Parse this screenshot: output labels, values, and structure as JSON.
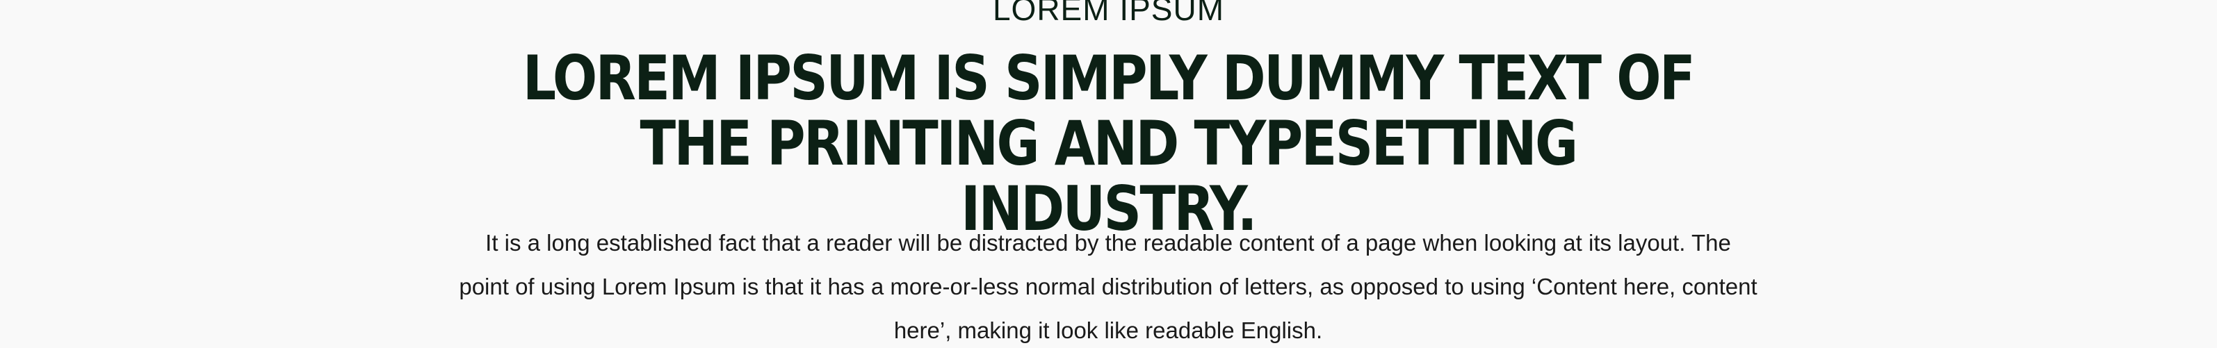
{
  "section": {
    "eyebrow": "LOREM IPSUM",
    "headline": "LOREM IPSUM IS SIMPLY DUMMY TEXT OF THE PRINTING AND TYPESETTING INDUSTRY.",
    "body": "It is a long established fact that a reader will be distracted by the readable content of a page when looking at its layout. The point of using Lorem Ipsum is that it has a more-or-less normal distribution of letters, as opposed to using ‘Content here, content here’, making it look like readable English."
  },
  "colors": {
    "background": "#f9f9f9",
    "text_dark_green": "#0c2015"
  }
}
